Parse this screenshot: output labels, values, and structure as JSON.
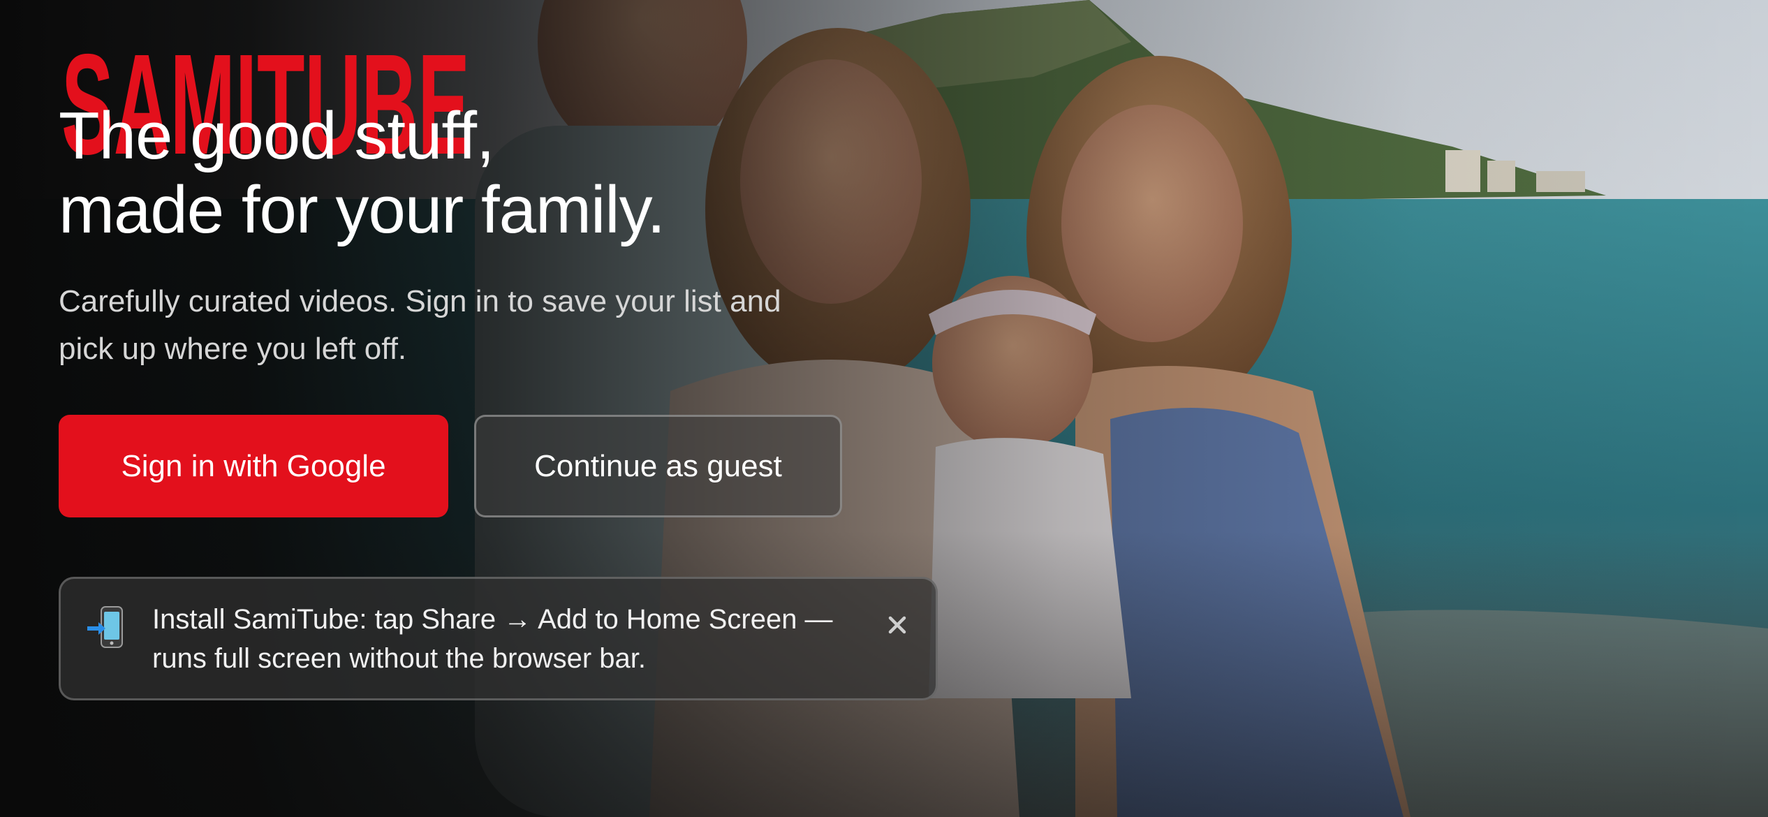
{
  "brand": {
    "logo_text": "SAMITUBE",
    "accent_color": "#e3101c"
  },
  "hero": {
    "headline_line1": "The good stuff,",
    "headline_line2": "made for your family.",
    "subtitle": "Carefully curated videos. Sign in to save your list and pick up where you left off."
  },
  "actions": {
    "google_label": "Sign in with Google",
    "guest_label": "Continue as guest"
  },
  "install_banner": {
    "icon": "mobile-arrow-icon",
    "message": "Install SamiTube: tap Share → Add to Home Screen — runs full screen without the browser bar.",
    "close_icon": "close-icon"
  },
  "background": {
    "description_icon": "family-beach-photo"
  }
}
